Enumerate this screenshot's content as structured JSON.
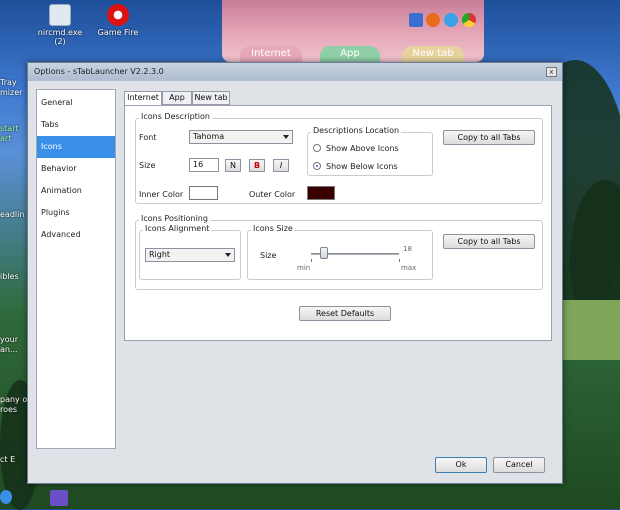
{
  "desktop": {
    "icons": [
      {
        "label": "nircmd.exe\n(2)"
      },
      {
        "label": "Game Fire"
      }
    ],
    "edge_labels": [
      "Tray\nmizer",
      "start\nart",
      "eadlin",
      "ibles",
      "your\nan...",
      "pany of\nroes",
      "ct E"
    ]
  },
  "launcher": {
    "tabs": [
      "Internet",
      "App",
      "New tab"
    ]
  },
  "dialog": {
    "title": "Options - sTabLauncher V2.2.3.0",
    "close_label": "x",
    "nav": [
      "General",
      "Tabs",
      "Icons",
      "Behavior",
      "Animation",
      "Plugins",
      "Advanced"
    ],
    "selected_nav": "Icons",
    "tabs": [
      "Internet",
      "App",
      "New tab"
    ],
    "active_tab": "Internet",
    "icons_description": {
      "group_label": "Icons Description",
      "font_label": "Font",
      "font_value": "Tahoma",
      "size_label": "Size",
      "size_value": "16",
      "style_buttons": [
        "N",
        "B",
        "I"
      ],
      "inner_color_label": "Inner Color",
      "inner_color": "#ffffff",
      "outer_color_label": "Outer Color",
      "outer_color": "#3a0000",
      "descriptions_location_label": "Descriptions Location",
      "radio_above": "Show Above Icons",
      "radio_below": "Show Below Icons",
      "selected_location": "Show Below Icons",
      "copy_button": "Copy to all Tabs"
    },
    "icons_positioning": {
      "group_label": "Icons Positioning",
      "alignment_label": "Icons Alignment",
      "alignment_value": "Right",
      "size_group_label": "Icons Size",
      "size_label": "Size",
      "slider_value": "18",
      "slider_min": "min",
      "slider_max": "max",
      "slider_fraction": 0.15,
      "copy_button": "Copy to all Tabs"
    },
    "reset_button": "Reset Defaults",
    "ok_button": "Ok",
    "cancel_button": "Cancel"
  },
  "colors": {
    "selection": "#3a8fe8",
    "outer_color": "#3a0000"
  }
}
